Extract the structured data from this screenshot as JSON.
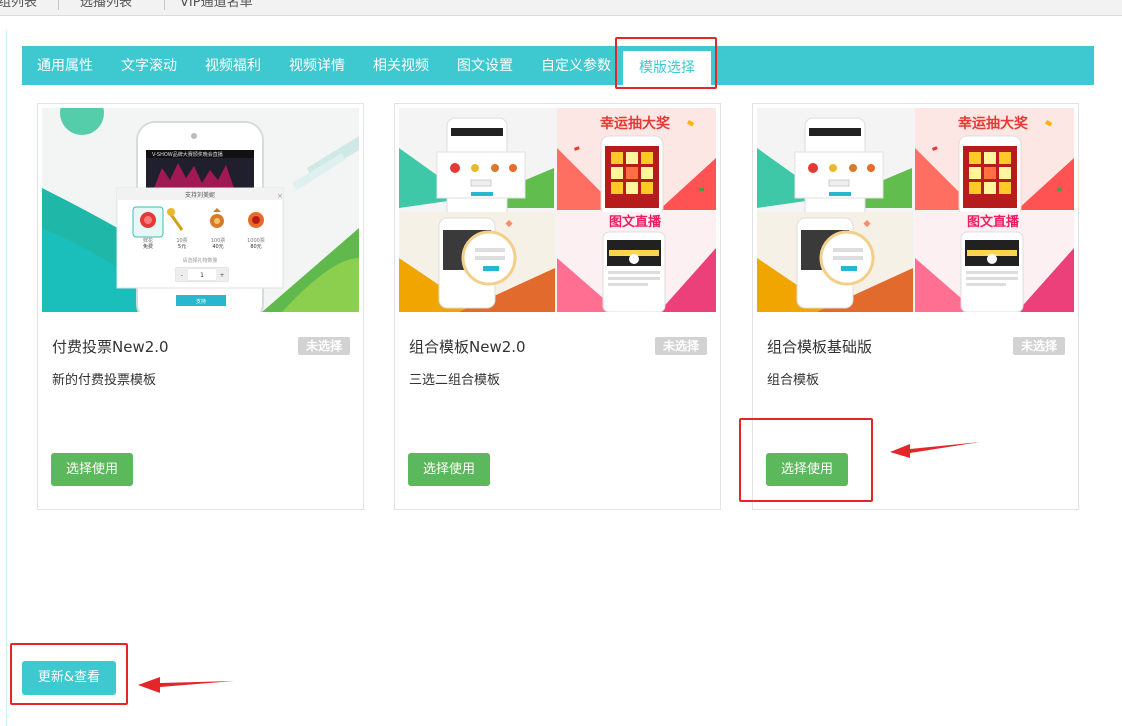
{
  "topbar": {
    "crumbs": [
      "组列表",
      "选播列表",
      "VIP通道名单"
    ]
  },
  "tabs": [
    {
      "label": "通用属性"
    },
    {
      "label": "文字滚动"
    },
    {
      "label": "视频福利"
    },
    {
      "label": "视频详情"
    },
    {
      "label": "相关视频"
    },
    {
      "label": "图文设置"
    },
    {
      "label": "自定义参数"
    },
    {
      "label": "模版选择",
      "active": true
    }
  ],
  "cards": [
    {
      "name": "付费投票New2.0",
      "status": "未选择",
      "description": "新的付费投票模板",
      "button": "选择使用",
      "preview": {
        "phone_title": "V-SHOW品牌大赛颁奖晚会直播",
        "modal_title": "支持刘美妮",
        "gifts": [
          {
            "name": "鲜花",
            "price": "免费"
          },
          {
            "name": "10票",
            "price": "5元"
          },
          {
            "name": "100票",
            "price": "40元"
          },
          {
            "name": "1000票",
            "price": "80元"
          }
        ],
        "hint": "请选择礼物数量",
        "qty": "1",
        "confirm": "支持"
      }
    },
    {
      "name": "组合模板New2.0",
      "status": "未选择",
      "description": "三选二组合模板",
      "button": "选择使用",
      "preview": {
        "banner_top": "幸运抽大奖",
        "banner_bottom": "图文直播"
      }
    },
    {
      "name": "组合模板基础版",
      "status": "未选择",
      "description": "组合模板",
      "button": "选择使用",
      "preview": {
        "banner_top": "幸运抽大奖",
        "banner_bottom": "图文直播"
      }
    }
  ],
  "footer": {
    "update_button": "更新&查看"
  },
  "colors": {
    "accent": "#3ec8cf",
    "success": "#5cb85c",
    "badge": "#d2d2d2",
    "annotation": "#e4262b"
  }
}
